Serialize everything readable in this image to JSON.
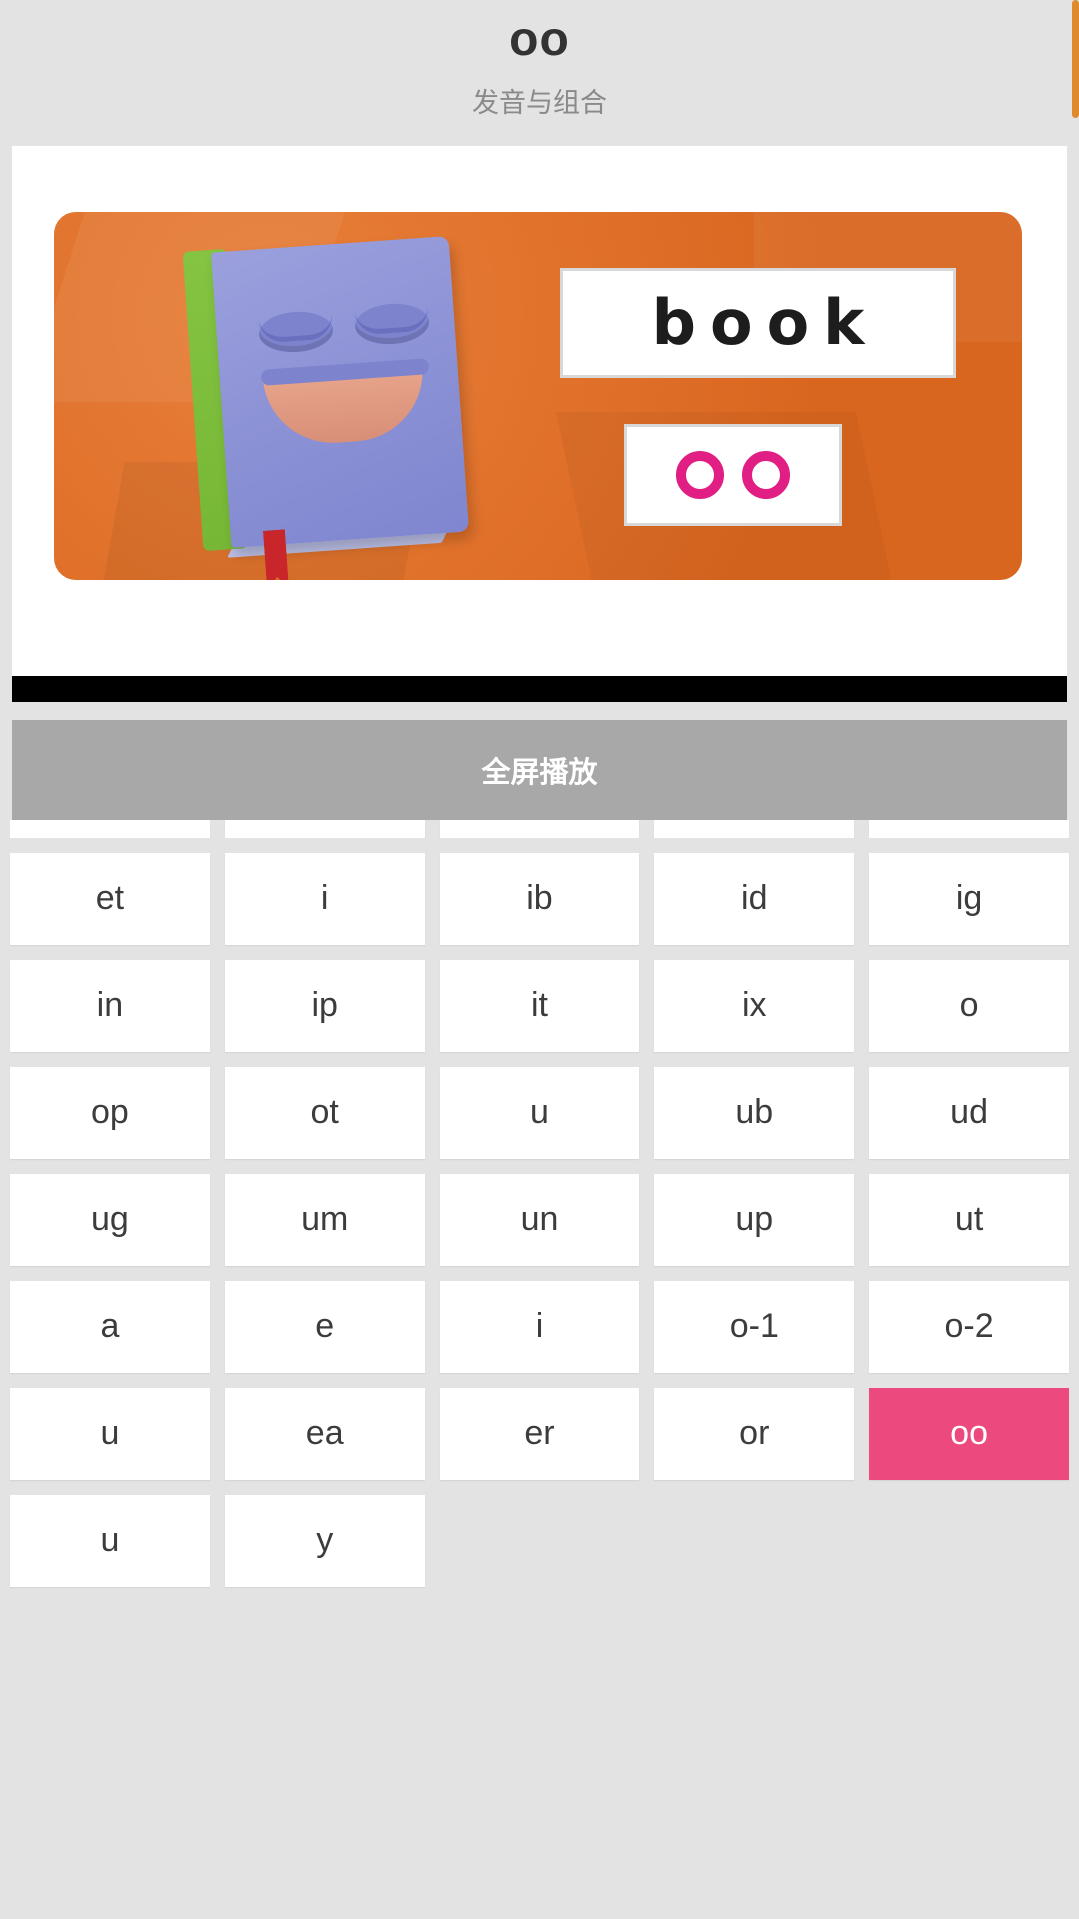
{
  "header": {
    "title": "oo",
    "subtitle": "发音与组合"
  },
  "video": {
    "word_label": "book",
    "pattern_label": "oo",
    "ring_icon": "circle-outline-icon"
  },
  "controls": {
    "fullscreen_label": "全屏播放"
  },
  "grid": {
    "partial_top_row": [
      "",
      "",
      "",
      "",
      ""
    ],
    "chips": [
      "et",
      "i",
      "ib",
      "id",
      "ig",
      "in",
      "ip",
      "it",
      "ix",
      "o",
      "op",
      "ot",
      "u",
      "ub",
      "ud",
      "ug",
      "um",
      "un",
      "up",
      "ut",
      "a",
      "e",
      "i",
      "o-1",
      "o-2",
      "u",
      "ea",
      "er",
      "or",
      "oo",
      "u",
      "y"
    ],
    "active_chip": "oo",
    "active_color": "#ec4a7f"
  },
  "scrollbar": {
    "accent_color": "#e08a2e"
  }
}
